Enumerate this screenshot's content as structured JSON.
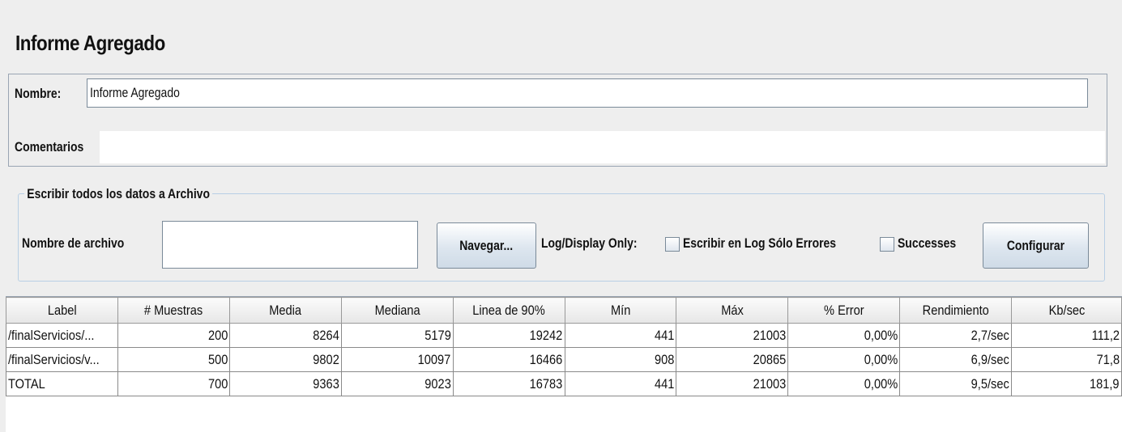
{
  "panel": {
    "title": "Informe Agregado",
    "name_label": "Nombre:",
    "name_value": "Informe Agregado",
    "comments_label": "Comentarios"
  },
  "file_section": {
    "legend": "Escribir todos los datos a Archivo",
    "filename_label": "Nombre de archivo",
    "filename_value": "",
    "browse_button": "Navegar...",
    "log_display_label": "Log/Display Only:",
    "errors_only_label": "Escribir en Log Sólo Errores",
    "errors_only_checked": false,
    "successes_label": "Successes",
    "successes_checked": false,
    "configure_button": "Configurar"
  },
  "table": {
    "columns": [
      "Label",
      "# Muestras",
      "Media",
      "Mediana",
      "Linea de 90%",
      "Mín",
      "Máx",
      "% Error",
      "Rendimiento",
      "Kb/sec"
    ],
    "rows": [
      [
        "/finalServicios/...",
        "200",
        "8264",
        "5179",
        "19242",
        "441",
        "21003",
        "0,00%",
        "2,7/sec",
        "111,2"
      ],
      [
        "/finalServicios/v...",
        "500",
        "9802",
        "10097",
        "16466",
        "908",
        "20865",
        "0,00%",
        "6,9/sec",
        "71,8"
      ],
      [
        "TOTAL",
        "700",
        "9363",
        "9023",
        "16783",
        "441",
        "21003",
        "0,00%",
        "9,5/sec",
        "181,9"
      ]
    ]
  }
}
